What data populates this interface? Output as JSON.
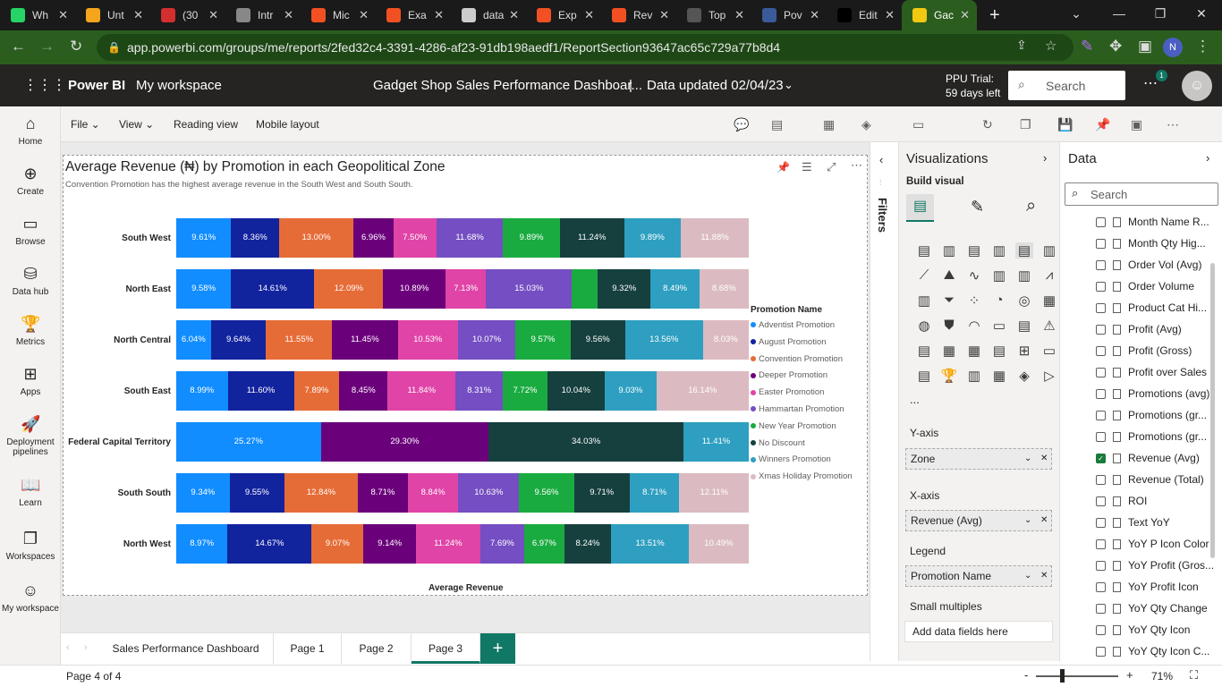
{
  "browser": {
    "tabs": [
      {
        "label": "Wh",
        "color": "#25d366"
      },
      {
        "label": "Unt",
        "color": "#f4a51c"
      },
      {
        "label": "(30",
        "color": "#d32f2f"
      },
      {
        "label": "Intr",
        "color": "#888888"
      },
      {
        "label": "Mic",
        "color": "#f25022"
      },
      {
        "label": "Exa",
        "color": "#f25022"
      },
      {
        "label": "data",
        "color": "#cccccc"
      },
      {
        "label": "Exp",
        "color": "#f25022"
      },
      {
        "label": "Rev",
        "color": "#f25022"
      },
      {
        "label": "Top",
        "color": "#555555"
      },
      {
        "label": "Pov",
        "color": "#3a5a9a"
      },
      {
        "label": "Edit",
        "color": "#000000"
      },
      {
        "label": "Gac",
        "color": "#f2c811"
      }
    ],
    "url": "app.powerbi.com/groups/me/reports/2fed32c4-3391-4286-af23-91db198aedf1/ReportSection93647ac65c729a77b8d4",
    "profile_initial": "N"
  },
  "header": {
    "brand": "Power BI",
    "workspace": "My workspace",
    "report_title": "Gadget Shop Sales Performance Dashboar...",
    "separator": "|",
    "data_updated": "Data updated 02/04/23",
    "trial_line1": "PPU Trial:",
    "trial_line2": "59 days left",
    "search_placeholder": "Search",
    "notif_count": "1"
  },
  "rail": [
    {
      "label": "Home",
      "icon": "⌂"
    },
    {
      "label": "Create",
      "icon": "⊕"
    },
    {
      "label": "Browse",
      "icon": "▭"
    },
    {
      "label": "Data hub",
      "icon": "⛁"
    },
    {
      "label": "Metrics",
      "icon": "🏆"
    },
    {
      "label": "Apps",
      "icon": "⊞"
    },
    {
      "label": "Deployment pipelines",
      "icon": "🚀"
    },
    {
      "label": "Learn",
      "icon": "📖"
    },
    {
      "label": "Workspaces",
      "icon": "❐"
    },
    {
      "label": "My workspace",
      "icon": "☺"
    }
  ],
  "toolbar": {
    "file": "File",
    "view": "View",
    "reading_view": "Reading view",
    "mobile_layout": "Mobile layout"
  },
  "visual": {
    "title": "Average Revenue (₦) by Promotion in each Geopolitical Zone",
    "subtitle": "Convention Promotion has the highest average revenue in the South West and South South.",
    "x_axis_label": "Average Revenue",
    "legend_title": "Promotion Name"
  },
  "chart_data": {
    "type": "bar",
    "orientation": "horizontal-100%-stacked",
    "categories": [
      "South West",
      "North East",
      "North Central",
      "South East",
      "Federal Capital Territory",
      "South South",
      "North West"
    ],
    "series": [
      {
        "name": "Adventist Promotion",
        "color": "#118dff",
        "values": [
          9.61,
          9.58,
          6.04,
          8.99,
          25.27,
          9.34,
          8.97
        ]
      },
      {
        "name": "August Promotion",
        "color": "#12239e",
        "values": [
          8.36,
          14.61,
          9.64,
          11.6,
          null,
          9.55,
          14.67
        ]
      },
      {
        "name": "Convention Promotion",
        "color": "#e66c37",
        "values": [
          13.0,
          12.09,
          11.55,
          7.89,
          null,
          12.84,
          9.07
        ]
      },
      {
        "name": "Deeper Promotion",
        "color": "#6b007b",
        "values": [
          6.96,
          10.89,
          11.45,
          8.45,
          29.3,
          8.71,
          9.14
        ]
      },
      {
        "name": "Easter Promotion",
        "color": "#e044a7",
        "values": [
          7.5,
          7.13,
          10.53,
          11.84,
          null,
          8.84,
          11.24
        ]
      },
      {
        "name": "Hammartan Promotion",
        "color": "#744ec2",
        "values": [
          11.68,
          15.03,
          10.07,
          8.31,
          null,
          10.63,
          7.69
        ]
      },
      {
        "name": "New Year Promotion",
        "color": "#1aab40",
        "values": [
          9.89,
          4.5,
          9.57,
          7.72,
          null,
          9.56,
          6.97
        ]
      },
      {
        "name": "No Discount",
        "color": "#15403e",
        "values": [
          11.24,
          9.32,
          9.56,
          10.04,
          34.03,
          9.71,
          8.24
        ]
      },
      {
        "name": "Winners Promotion",
        "color": "#2e9fc0",
        "values": [
          9.89,
          8.49,
          13.56,
          9.03,
          11.41,
          8.71,
          13.51
        ]
      },
      {
        "name": "Xmas Holiday Promotion",
        "color": "#dbbbc1",
        "values": [
          11.88,
          8.68,
          8.03,
          16.14,
          null,
          12.11,
          10.49
        ]
      }
    ],
    "labels_hidden": [
      [
        1,
        6
      ]
    ],
    "xlabel": "Average Revenue",
    "legend_position": "right"
  },
  "viz_pane": {
    "title": "Visualizations",
    "build_visual": "Build visual",
    "more": "...",
    "y_axis": "Y-axis",
    "y_field": "Zone",
    "x_axis": "X-axis",
    "x_field": "Revenue (Avg)",
    "legend": "Legend",
    "legend_field": "Promotion Name",
    "small_multiples": "Small multiples",
    "add_fields": "Add data fields here",
    "filters_label": "Filters"
  },
  "data_pane": {
    "title": "Data",
    "search_placeholder": "Search",
    "fields": [
      {
        "label": "Month Name R...",
        "checked": false
      },
      {
        "label": "Month Qty Hig...",
        "checked": false
      },
      {
        "label": "Order Vol (Avg)",
        "checked": false
      },
      {
        "label": "Order Volume",
        "checked": false
      },
      {
        "label": "Product Cat Hi...",
        "checked": false
      },
      {
        "label": "Profit (Avg)",
        "checked": false
      },
      {
        "label": "Profit (Gross)",
        "checked": false
      },
      {
        "label": "Profit over Sales",
        "checked": false
      },
      {
        "label": "Promotions (avg)",
        "checked": false
      },
      {
        "label": "Promotions (gr...",
        "checked": false
      },
      {
        "label": "Promotions (gr...",
        "checked": false
      },
      {
        "label": "Revenue (Avg)",
        "checked": true
      },
      {
        "label": "Revenue (Total)",
        "checked": false
      },
      {
        "label": "ROI",
        "checked": false
      },
      {
        "label": "Text YoY",
        "checked": false
      },
      {
        "label": "YoY P Icon Color",
        "checked": false
      },
      {
        "label": "YoY Profit (Gros...",
        "checked": false
      },
      {
        "label": "YoY Profit Icon",
        "checked": false
      },
      {
        "label": "YoY Qty Change",
        "checked": false
      },
      {
        "label": "YoY Qty Icon",
        "checked": false
      },
      {
        "label": "YoY Qty Icon C...",
        "checked": false
      }
    ]
  },
  "pages": {
    "tabs": [
      "Sales Performance Dashboard",
      "Page 1",
      "Page 2",
      "Page 3"
    ],
    "active": "Page 3",
    "add": "+"
  },
  "status": {
    "page_info": "Page 4 of 4",
    "zoom": "71%",
    "minus": "-",
    "plus": "+"
  }
}
